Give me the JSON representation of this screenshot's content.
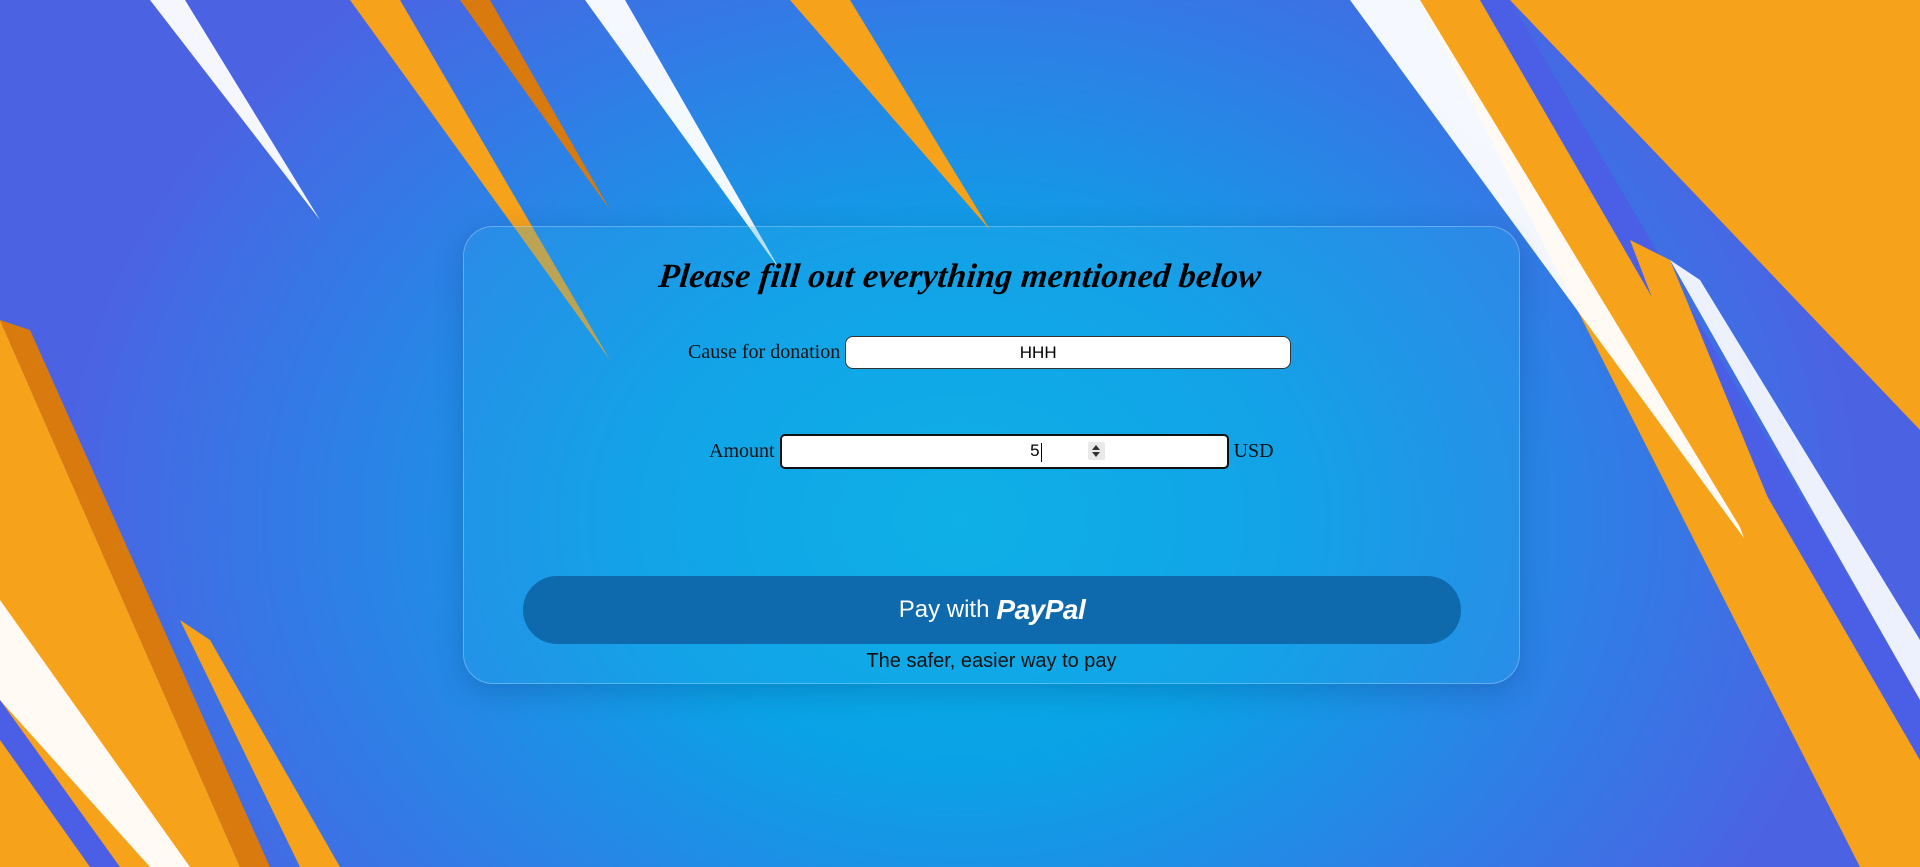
{
  "form": {
    "heading": "Please fill out everything mentioned below",
    "cause": {
      "label": "Cause for donation",
      "value": "HHH"
    },
    "amount": {
      "label": "Amount",
      "value": "5",
      "currency": "USD"
    }
  },
  "paypal": {
    "pay_label": "Pay with",
    "brand": "PayPal",
    "tagline": "The safer, easier way to pay",
    "button_color": "#0f6aad"
  },
  "theme": {
    "accent_orange": "#f7a21b",
    "background_blue": "#1aa6e8"
  }
}
